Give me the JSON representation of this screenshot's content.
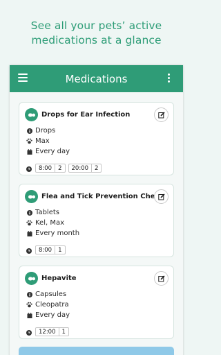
{
  "headline": {
    "line1": "See all your pets’ active",
    "line2": "medications at a glance"
  },
  "appbar": {
    "title": "Medications",
    "menu_icon": "hamburger-menu-icon",
    "more_icon": "more-vert-icon"
  },
  "colors": {
    "brand": "#2f9c77",
    "headline": "#2e9d77",
    "background": "#eef6f4"
  },
  "medications": [
    {
      "name": "Drops for Ear Infection",
      "form": "Drops",
      "pets": "Max",
      "frequency": "Every day",
      "times": [
        {
          "time": "8:00",
          "qty": "2"
        },
        {
          "time": "20:00",
          "qty": "2"
        }
      ]
    },
    {
      "name": "Flea and Tick Prevention Chew",
      "form": "Tablets",
      "pets": "Kel, Max",
      "frequency": "Every month",
      "times": [
        {
          "time": "8:00",
          "qty": "1"
        }
      ]
    },
    {
      "name": "Hepavite",
      "form": "Capsules",
      "pets": "Cleopatra",
      "frequency": "Every day",
      "times": [
        {
          "time": "12:00",
          "qty": "1"
        }
      ]
    }
  ]
}
